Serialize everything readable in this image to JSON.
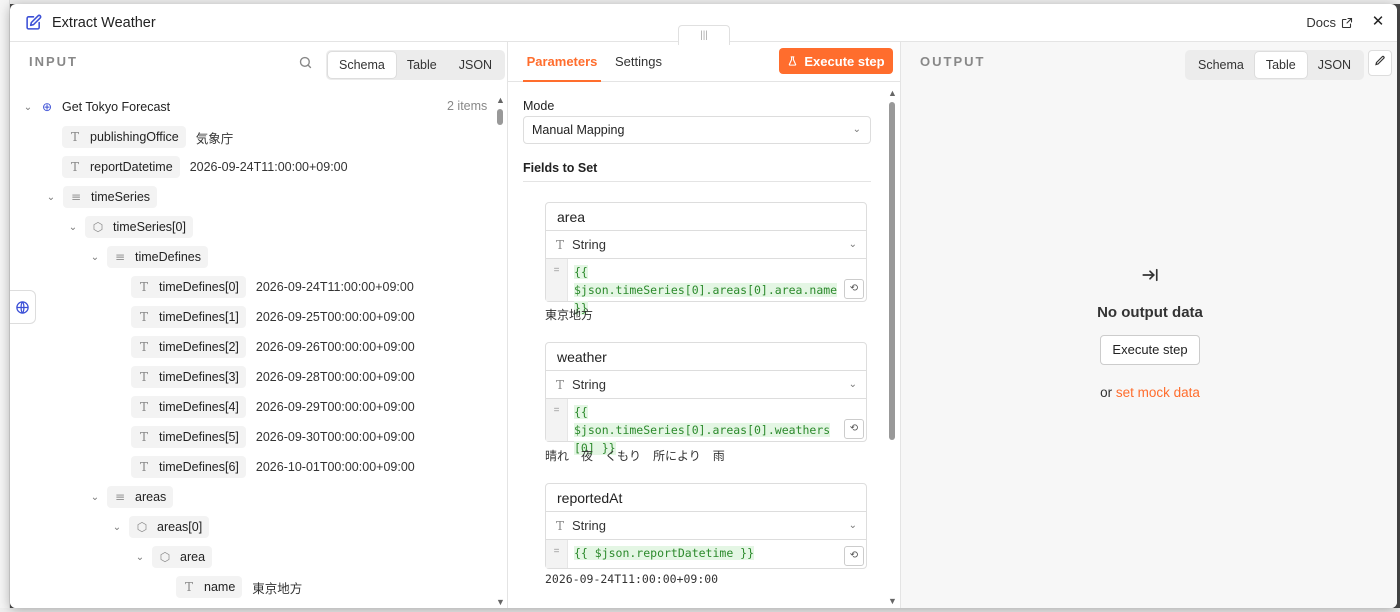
{
  "window": {
    "title": "Extract Weather",
    "docs_label": "Docs",
    "close_glyph": "✕"
  },
  "input": {
    "label": "INPUT",
    "view_options": [
      "Schema",
      "Table",
      "JSON"
    ],
    "active_view": "Schema",
    "items_count": "2 items",
    "tree": [
      {
        "key": "Get Tokyo Forecast",
        "value": "",
        "icon": "globe-icon",
        "chevron": true
      },
      {
        "key": "publishingOffice",
        "value": "気象庁",
        "icon": "text-type-icon"
      },
      {
        "key": "reportDatetime",
        "value": "2026-09-24T11:00:00+09:00",
        "icon": "text-type-icon"
      },
      {
        "key": "timeSeries",
        "value": "",
        "icon": "list-type-icon",
        "chevron": true
      },
      {
        "key": "timeSeries[0]",
        "value": "",
        "icon": "object-type-icon",
        "chevron": true
      },
      {
        "key": "timeDefines",
        "value": "",
        "icon": "list-type-icon",
        "chevron": true
      },
      {
        "key": "timeDefines[0]",
        "value": "2026-09-24T11:00:00+09:00",
        "icon": "text-type-icon"
      },
      {
        "key": "timeDefines[1]",
        "value": "2026-09-25T00:00:00+09:00",
        "icon": "text-type-icon"
      },
      {
        "key": "timeDefines[2]",
        "value": "2026-09-26T00:00:00+09:00",
        "icon": "text-type-icon"
      },
      {
        "key": "timeDefines[3]",
        "value": "2026-09-28T00:00:00+09:00",
        "icon": "text-type-icon"
      },
      {
        "key": "timeDefines[4]",
        "value": "2026-09-29T00:00:00+09:00",
        "icon": "text-type-icon"
      },
      {
        "key": "timeDefines[5]",
        "value": "2026-09-30T00:00:00+09:00",
        "icon": "text-type-icon"
      },
      {
        "key": "timeDefines[6]",
        "value": "2026-10-01T00:00:00+09:00",
        "icon": "text-type-icon"
      },
      {
        "key": "areas",
        "value": "",
        "icon": "list-type-icon",
        "chevron": true
      },
      {
        "key": "areas[0]",
        "value": "",
        "icon": "object-type-icon",
        "chevron": true
      },
      {
        "key": "area",
        "value": "",
        "icon": "object-type-icon",
        "chevron": true
      },
      {
        "key": "name",
        "value": "東京地方",
        "icon": "text-type-icon"
      }
    ]
  },
  "parameters": {
    "tabs": [
      "Parameters",
      "Settings"
    ],
    "active_tab": "Parameters",
    "execute_label": "Execute step",
    "mode_label": "Mode",
    "mode_value": "Manual Mapping",
    "fields_label": "Fields to Set",
    "fields": [
      {
        "name": "area",
        "type": "String",
        "expression": [
          "{{ $json.timeSeries[0].areas[0].area.name",
          "}}"
        ],
        "preview": "東京地方"
      },
      {
        "name": "weather",
        "type": "String",
        "expression": [
          "{{ $json.timeSeries[0].areas[0].weathers",
          "[0] }}"
        ],
        "preview": "晴れ　夜　くもり　所により　雨"
      },
      {
        "name": "reportedAt",
        "type": "String",
        "expression": [
          "{{ $json.reportDatetime }}"
        ],
        "preview": "2026-09-24T11:00:00+09:00"
      }
    ]
  },
  "output": {
    "label": "OUTPUT",
    "view_options": [
      "Schema",
      "Table",
      "JSON"
    ],
    "active_view": "Table",
    "empty_title": "No output data",
    "execute_label": "Execute step",
    "mock_prefix": "or",
    "mock_link": "set mock data"
  },
  "colors": {
    "accent": "#ff6d2d",
    "brand_icon": "#3b4fd6",
    "expression": "#2c8a2c"
  }
}
